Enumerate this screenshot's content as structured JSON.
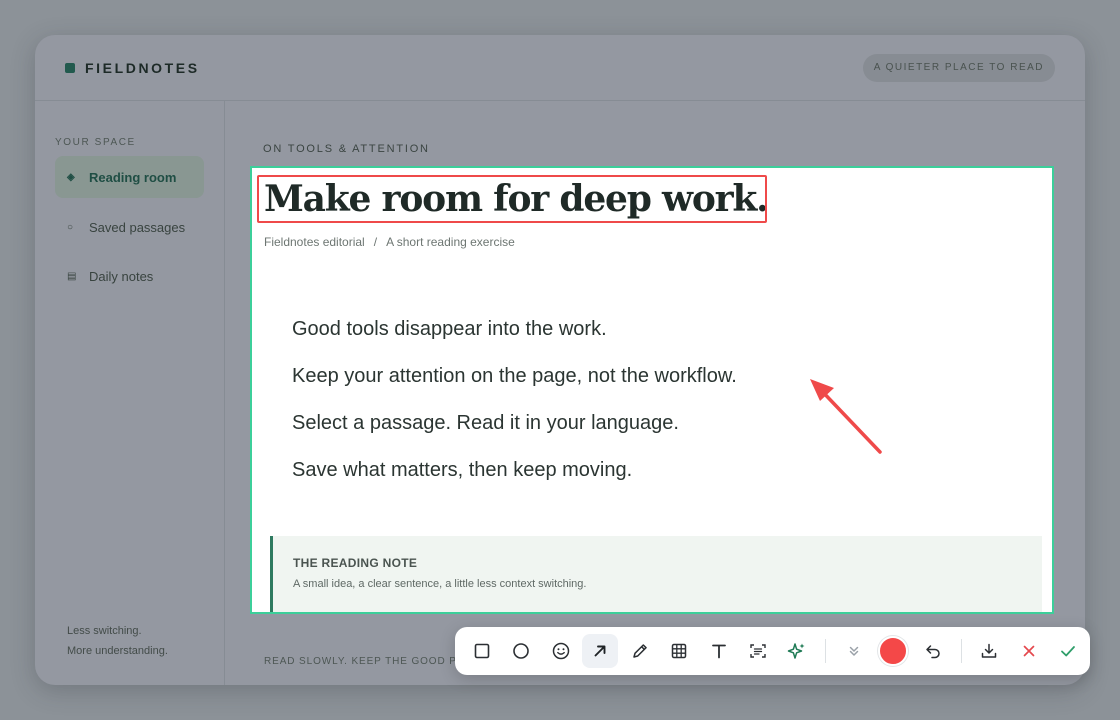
{
  "app": {
    "brand_name": "FIELDNOTES",
    "tagline": "A QUIETER PLACE TO READ",
    "brand_color": "#225a4e"
  },
  "sidebar": {
    "heading": "YOUR SPACE",
    "items": [
      {
        "label": "Reading room",
        "icon": "diamond-icon",
        "active": true
      },
      {
        "label": "Saved passages",
        "icon": "circle-icon",
        "active": false
      },
      {
        "label": "Daily notes",
        "icon": "notes-icon",
        "active": false
      }
    ],
    "footer_line1": "Less switching.",
    "footer_line2": "More understanding."
  },
  "article": {
    "eyebrow": "ON TOOLS & ATTENTION",
    "title": "Make room for deep work.",
    "author": "Fieldnotes editorial",
    "byline_separator": "/",
    "subtitle": "A short reading exercise",
    "lines": [
      "Good tools disappear into the work.",
      "Keep your attention on the page, not the workflow.",
      "Select a passage. Read it in your language.",
      "Save what matters, then keep moving."
    ],
    "note_title": "THE READING NOTE",
    "note_body": "A small idea, a clear sentence, a little less context switching.",
    "footer": "READ SLOWLY. KEEP THE GOOD PARTS."
  },
  "annotation": {
    "selection_color": "#3ccf9a",
    "markup_color": "#ef4a4a",
    "title_highlight": "rectangle",
    "pointer": "arrow"
  },
  "toolbar": {
    "tools": [
      {
        "name": "rectangle-tool",
        "icon": "square-icon",
        "active": false
      },
      {
        "name": "ellipse-tool",
        "icon": "circle-icon",
        "active": false
      },
      {
        "name": "emoji-tool",
        "icon": "smiley-icon",
        "active": false
      },
      {
        "name": "arrow-tool",
        "icon": "arrow-up-right-icon",
        "active": true
      },
      {
        "name": "pen-tool",
        "icon": "pencil-icon",
        "active": false
      },
      {
        "name": "mosaic-tool",
        "icon": "grid-icon",
        "active": false
      },
      {
        "name": "text-tool",
        "icon": "text-icon",
        "active": false
      },
      {
        "name": "ocr-tool",
        "icon": "scan-text-icon",
        "active": false
      },
      {
        "name": "ai-tool",
        "icon": "sparkle-icon",
        "active": false
      }
    ],
    "current_color": "#f44848",
    "actions": [
      "collapse-icon",
      "undo-icon",
      "download-icon",
      "close-icon",
      "check-icon"
    ]
  }
}
